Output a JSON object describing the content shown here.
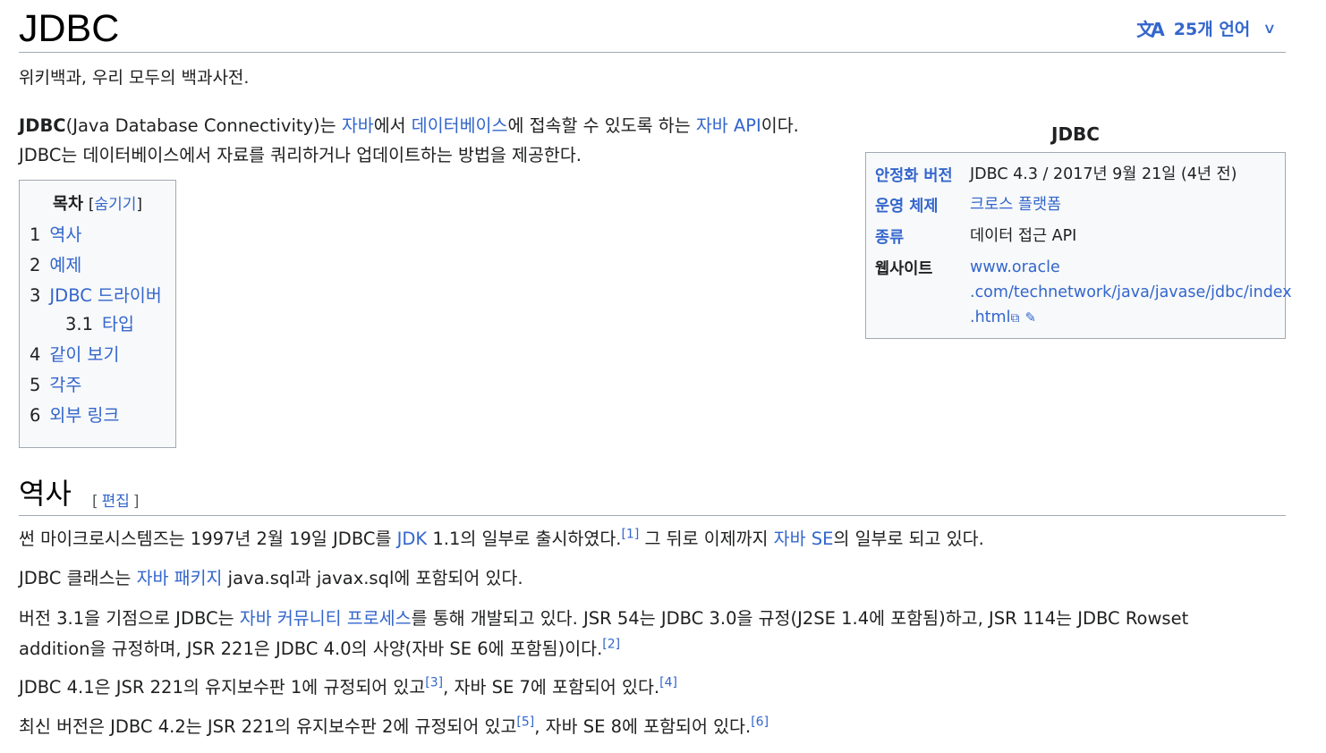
{
  "article": {
    "title": "JDBC",
    "languages_label": "25개 언어",
    "language_icon": "translate-icon",
    "tagline": "위키백과, 우리 모두의 백과사전."
  },
  "lead": {
    "subject": "JDBC",
    "t1": "(Java Database Connectivity)는 ",
    "l1": "자바",
    "t2": "에서 ",
    "l2": "데이터베이스",
    "t3": "에 접속할 수 있도록 하는 ",
    "l3": "자바 API",
    "t4": "이다. JDBC는 데이터베이스에서 자료를 쿼리하거나 업데이트하는 방법을 제공한다."
  },
  "toc": {
    "title": "목차",
    "toggle": "숨기기",
    "items": [
      {
        "num": "1",
        "label": "역사"
      },
      {
        "num": "2",
        "label": "예제"
      },
      {
        "num": "3",
        "label": "JDBC 드라이버"
      },
      {
        "num": "3.1",
        "label": "타입"
      },
      {
        "num": "4",
        "label": "같이 보기"
      },
      {
        "num": "5",
        "label": "각주"
      },
      {
        "num": "6",
        "label": "외부 링크"
      }
    ]
  },
  "infobox": {
    "title": "JDBC",
    "rows": [
      {
        "label": "안정화 버전",
        "value": "JDBC 4.3 / 2017년 9월 21일 (4년 전)"
      },
      {
        "label": "운영 체제",
        "value": "크로스 플랫폼"
      },
      {
        "label": "종류",
        "value": "데이터 접근 API"
      },
      {
        "label": "웹사이트",
        "value_lines": [
          "www.oracle",
          ".com/technetwork/java/javase/jdbc/index",
          ".html"
        ]
      }
    ]
  },
  "history": {
    "title": "역사",
    "edit": "편집",
    "p1": {
      "a": "썬 마이크로시스템즈는 1997년 2월 19일 JDBC를 ",
      "l1": "JDK",
      "b": " 1.1의 일부로 출시하였다.",
      "ref1": "[1]",
      "c": " 그 뒤로 이제까지 ",
      "l2": "자바 SE",
      "d": "의 일부로 되고 있다."
    },
    "p2": {
      "a": "JDBC 클래스는 ",
      "l1": "자바 패키지",
      "b": " java.sql과 javax.sql에 포함되어 있다."
    },
    "p3": {
      "a": "버전 3.1을 기점으로 JDBC는 ",
      "l1": "자바 커뮤니티 프로세스",
      "b": "를 통해 개발되고 있다. JSR 54는 JDBC 3.0을 규정(J2SE 1.4에 포함됨)하고, JSR 114는 JDBC Rowset addition을 규정하며, JSR 221은 JDBC 4.0의 사양(자바 SE 6에 포함됨)이다.",
      "ref": "[2]"
    },
    "p4": {
      "a": "JDBC 4.1은 JSR 221의 유지보수판 1에 규정되어 있고",
      "ref1": "[3]",
      "b": ", 자바 SE 7에 포함되어 있다.",
      "ref2": "[4]"
    },
    "p5": {
      "a": "최신 버전은 JDBC 4.2는 JSR 221의 유지보수판 2에 규정되어 있고",
      "ref1": "[5]",
      "b": ", 자바 SE 8에 포함되어 있다.",
      "ref2": "[6]"
    }
  }
}
